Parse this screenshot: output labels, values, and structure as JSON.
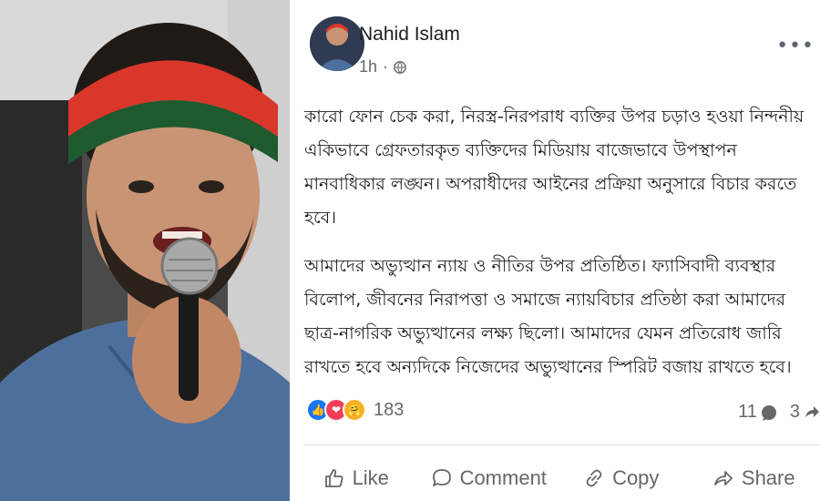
{
  "post": {
    "author": "Nahid Islam",
    "time": "1h",
    "more_icon": "more-horizontal-icon",
    "paragraphs": [
      "কারো ফোন চেক করা, নিরস্ত্র-নিরপরাধ ব্যক্তির উপর চড়াও হওয়া নিন্দনীয় একিভাবে গ্রেফতারকৃত ব্যক্তিদের মিডিয়ায় বাজেভাবে উপস্থাপন মানবাধিকার লঙ্ঘন। অপরাধীদের আইনের প্রক্রিয়া অনুসারে বিচার করতে হবে।",
      "আমাদের অভ্যুত্থান ন্যায় ও নীতির উপর প্রতিষ্ঠিত। ফ্যাসিবাদী ব্যবস্থার বিলোপ, জীবনের নিরাপত্তা ও সমাজে ন্যায়বিচার প্রতিষ্ঠা করা আমাদের ছাত্র-নাগরিক অভ্যুত্থানের লক্ষ্য ছিলো। আমাদের যেমন প্রতিরোধ জারি রাখতে হবে অন্যদিকে নিজেদের অভ্যুত্থানের স্পিরিট বজায় রাখতে হবে।"
    ]
  },
  "stats": {
    "reaction_count": "183",
    "comment_count": "11",
    "share_count": "3"
  },
  "actions": {
    "like": "Like",
    "comment": "Comment",
    "copy": "Copy",
    "share": "Share"
  },
  "colors": {
    "brand_blue": "#1877f2",
    "muted_text": "#65676b",
    "headband_red": "#d8372a",
    "headband_green": "#1e5a2e"
  }
}
